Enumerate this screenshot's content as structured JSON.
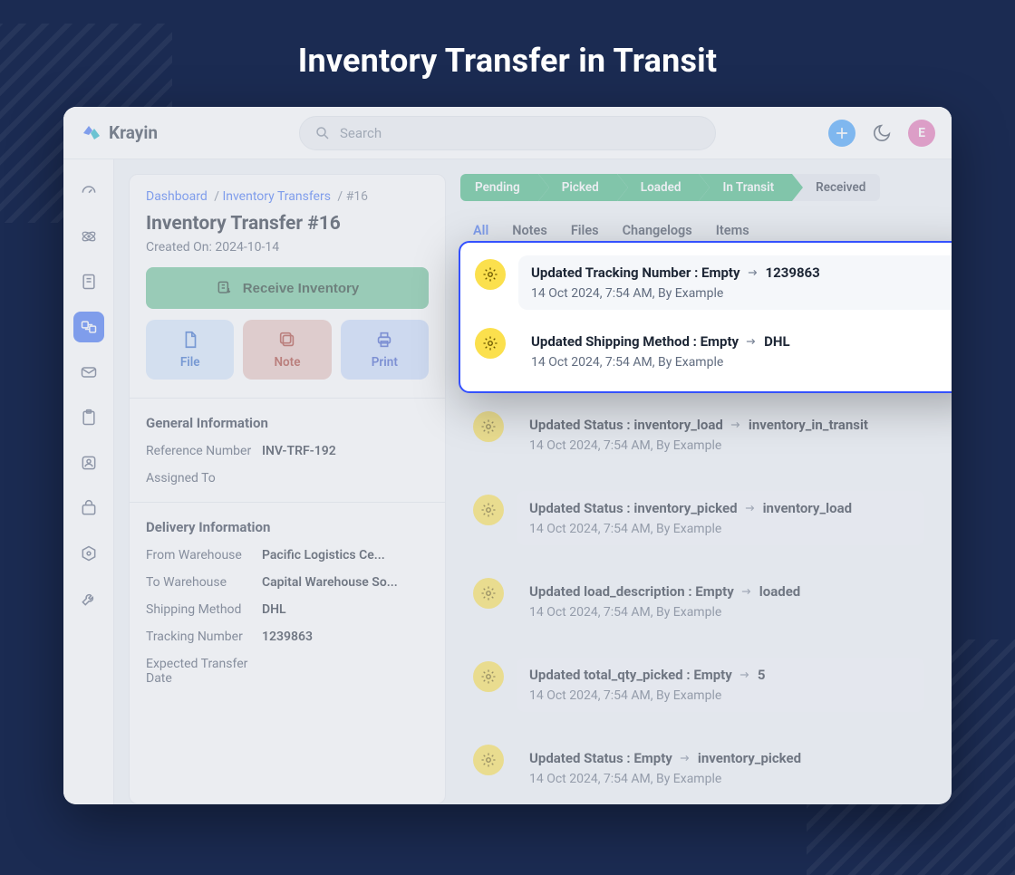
{
  "hero_title": "Inventory Transfer in Transit",
  "brand": {
    "name": "Krayin"
  },
  "search": {
    "placeholder": "Search"
  },
  "avatar": {
    "initial": "E"
  },
  "breadcrumbs": {
    "dashboard": "Dashboard",
    "transfers": "Inventory Transfers",
    "current": "#16"
  },
  "page": {
    "title": "Inventory Transfer #16",
    "created_label": "Created On:",
    "created_on": "2024-10-14",
    "receive_label": "Receive Inventory"
  },
  "action_chips": {
    "file": "File",
    "note": "Note",
    "print": "Print"
  },
  "general": {
    "heading": "General Information",
    "ref_label": "Reference Number",
    "ref_value": "INV-TRF-192",
    "assigned_label": "Assigned To",
    "assigned_value": ""
  },
  "delivery": {
    "heading": "Delivery Information",
    "from_label": "From Warehouse",
    "from_value": "Pacific Logistics Ce...",
    "to_label": "To Warehouse",
    "to_value": "Capital Warehouse So...",
    "ship_label": "Shipping Method",
    "ship_value": "DHL",
    "track_label": "Tracking Number",
    "track_value": "1239863",
    "eta_label": "Expected Transfer Date",
    "eta_value": ""
  },
  "stages": {
    "pending": "Pending",
    "picked": "Picked",
    "loaded": "Loaded",
    "in_transit": "In Transit",
    "received": "Received"
  },
  "tabs": {
    "all": "All",
    "notes": "Notes",
    "files": "Files",
    "changelogs": "Changelogs",
    "items": "Items"
  },
  "feed_meta_default": "14 Oct 2024, 7:54 AM, By Example",
  "feed": [
    {
      "title_prefix": "Updated Tracking Number :",
      "from": "Empty",
      "to": "1239863"
    },
    {
      "title_prefix": "Updated Shipping Method :",
      "from": "Empty",
      "to": "DHL"
    },
    {
      "title_prefix": "Updated Status :",
      "from": "inventory_load",
      "to": "inventory_in_transit"
    },
    {
      "title_prefix": "Updated Status :",
      "from": "inventory_picked",
      "to": "inventory_load"
    },
    {
      "title_prefix": "Updated load_description :",
      "from": "Empty",
      "to": "loaded"
    },
    {
      "title_prefix": "Updated total_qty_picked :",
      "from": "Empty",
      "to": "5"
    },
    {
      "title_prefix": "Updated Status :",
      "from": "Empty",
      "to": "inventory_picked"
    }
  ]
}
